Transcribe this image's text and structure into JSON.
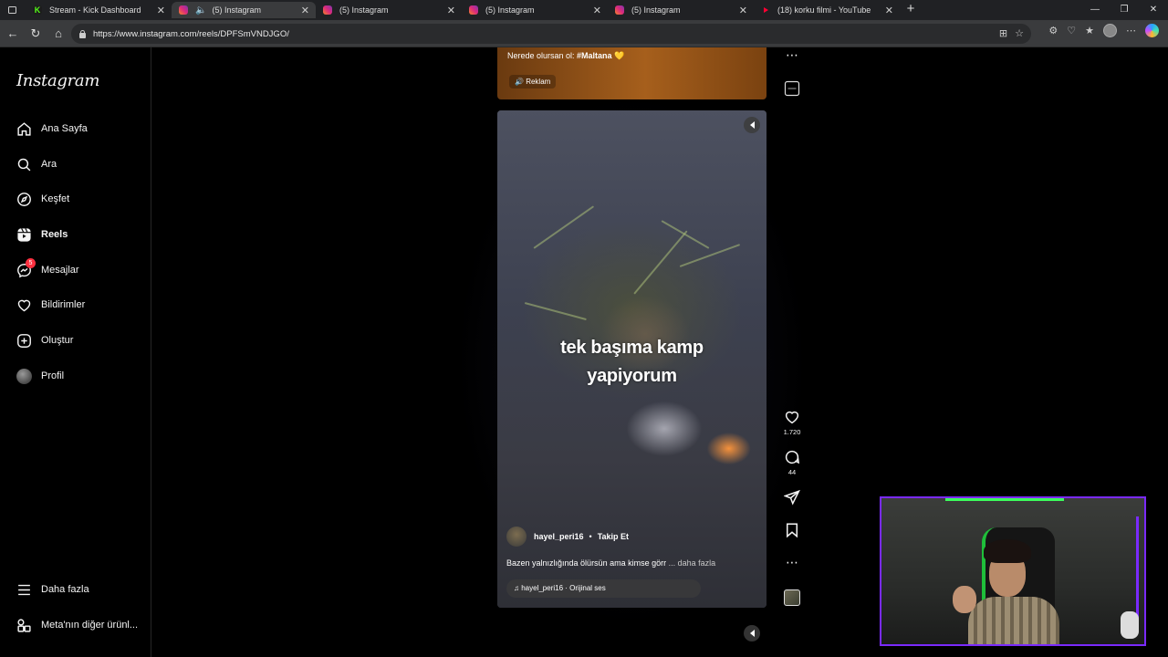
{
  "browser": {
    "tabs": [
      {
        "title": "Stream - Kick Dashboard",
        "favicon": "kick-icon",
        "active": false
      },
      {
        "title": "(5) Instagram",
        "favicon": "instagram-icon",
        "active": true,
        "audio": true
      },
      {
        "title": "(5) Instagram",
        "favicon": "instagram-icon",
        "active": false
      },
      {
        "title": "(5) Instagram",
        "favicon": "instagram-icon",
        "active": false
      },
      {
        "title": "(5) Instagram",
        "favicon": "instagram-icon",
        "active": false
      },
      {
        "title": "(18) korku filmi - YouTube",
        "favicon": "youtube-icon",
        "active": false
      }
    ],
    "url": "https://www.instagram.com/reels/DPFSmVNDJGO/"
  },
  "sidebar": {
    "logo": "Instagram",
    "items": [
      {
        "label": "Ana Sayfa",
        "icon": "home-icon"
      },
      {
        "label": "Ara",
        "icon": "search-icon"
      },
      {
        "label": "Keşfet",
        "icon": "compass-icon"
      },
      {
        "label": "Reels",
        "icon": "reels-icon",
        "active": true
      },
      {
        "label": "Mesajlar",
        "icon": "messenger-icon",
        "badge": "5"
      },
      {
        "label": "Bildirimler",
        "icon": "heart-icon"
      },
      {
        "label": "Oluştur",
        "icon": "plus-square-icon"
      },
      {
        "label": "Profil",
        "icon": "profile-avatar"
      }
    ],
    "more": "Daha fazla",
    "meta": "Meta'nın diğer ürünl..."
  },
  "prev_reel": {
    "caption_prefix": "Nerede olursan ol: ",
    "caption_tag": "#Maltana",
    "emoji": "💛",
    "ad_label": "Reklam"
  },
  "reel": {
    "title_line1": "tek başıma kamp",
    "title_line2": "yapiyorum",
    "username": "hayel_peri16",
    "follow": "Takip Et",
    "description": "Bazen yalnızlığında ölürsün ama kimse görr",
    "more": "... daha fazla",
    "audio": "hayel_peri16 · Orijinal ses",
    "likes": "1.720",
    "comments": "44"
  },
  "colors": {
    "background": "#000000",
    "badge": "#ff3040",
    "webcam_border": "#7a2aff",
    "webcam_neon": "#3cff5c"
  }
}
